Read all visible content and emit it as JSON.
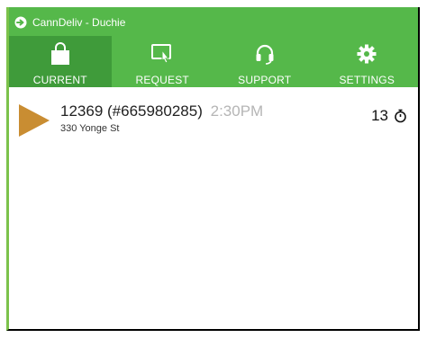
{
  "window": {
    "title": "CannDeliv - Duchie"
  },
  "tabs": [
    {
      "label": "CURRENT",
      "icon": "shopping-bag-icon",
      "active": true
    },
    {
      "label": "REQUEST",
      "icon": "request-touch-icon",
      "active": false
    },
    {
      "label": "SUPPORT",
      "icon": "headset-icon",
      "active": false
    },
    {
      "label": "SETTINGS",
      "icon": "gear-icon",
      "active": false
    }
  ],
  "orders": [
    {
      "number": "12369 (#665980285)",
      "time": "2:30PM",
      "address": "330 Yonge St",
      "countdown": "13",
      "icon": "play-icon"
    }
  ],
  "colors": {
    "header": "#55b84a",
    "active_tab": "#3f9b3a",
    "play_icon": "#c98d32",
    "time_text": "#b5b5b5"
  }
}
